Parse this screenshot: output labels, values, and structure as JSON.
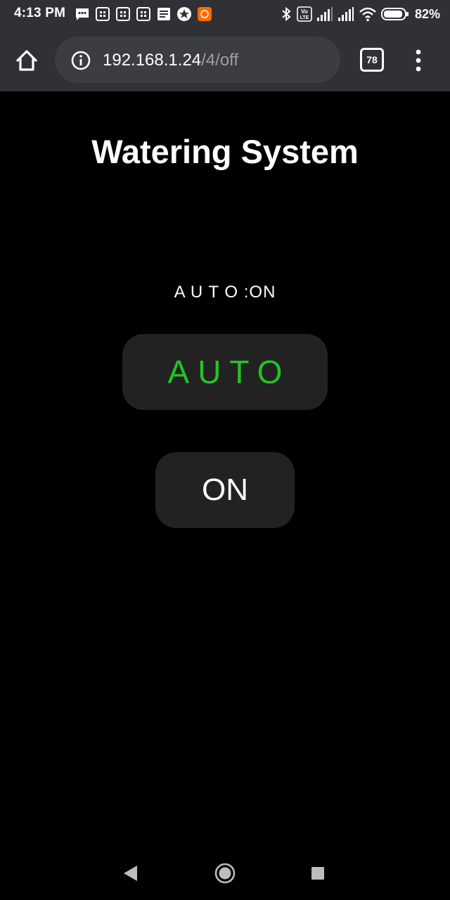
{
  "status_bar": {
    "time": "4:13 PM",
    "battery_percent": "82%",
    "notification_icons": [
      "messages-icon",
      "sim-app-icon",
      "sim-app-icon",
      "sim-app-icon",
      "document-icon",
      "browser-icon",
      "mi-app-icon"
    ]
  },
  "browser": {
    "url_host": "192.168.1.24",
    "url_path": "/4/off",
    "tab_count": "78"
  },
  "page": {
    "title": "Watering System",
    "mode_status": "A U T O :ON",
    "auto_button_label": "AUTO",
    "on_button_label": "ON"
  },
  "colors": {
    "background": "#000000",
    "button_background": "#222222",
    "auto_label": "#24c424",
    "browser_chrome": "#303134"
  }
}
